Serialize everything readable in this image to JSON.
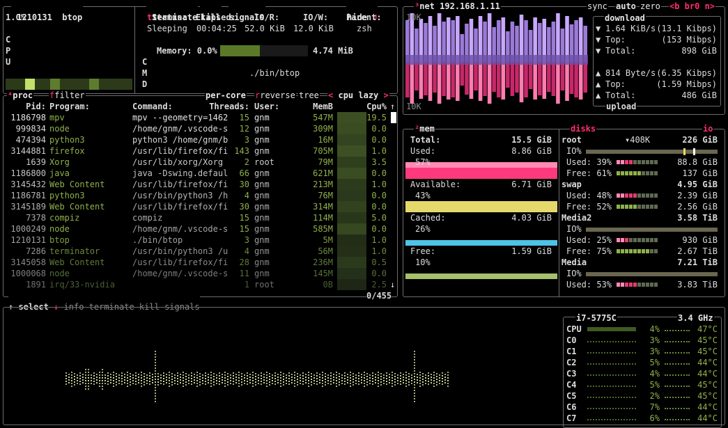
{
  "header": {
    "pid": "1210131",
    "name": "btop",
    "cpu_pct": "1.0%",
    "cpu_letters": [
      "C",
      "P",
      "U"
    ]
  },
  "detail": {
    "buttons": {
      "terminate": "terminate",
      "kill": "kill",
      "signals": "signals",
      "hide": "hide"
    },
    "status_label": "Status:",
    "status": "Sleeping",
    "elapsed_label": "Elapsed:",
    "elapsed": "00:04:25",
    "ior_label": "IO/R:",
    "ior": "52.0 KiB",
    "iow_label": "IO/W:",
    "iow": "12.0 KiB",
    "parent_label": "Parent:",
    "parent": "zsh",
    "memory_label": "Memory: 0.0%",
    "memory_value": "4.74 MiB",
    "cmd_letters": [
      "C",
      "M",
      "D"
    ],
    "command": "./bin/btop",
    "memory_fraction": 0.45
  },
  "proc": {
    "title": "proc",
    "filter": "filter",
    "per_core": "per-core",
    "reverse": "reverse",
    "tree": "tree",
    "sort_label": "cpu lazy",
    "columns": [
      "Pid:",
      "Program:",
      "Command:",
      "Threads:",
      "User:",
      "MemB",
      "Cpu%"
    ],
    "rows": [
      {
        "pid": "1186798",
        "program": "mpv",
        "command": "mpv --geometry=1462",
        "threads": "15",
        "user": "gnm",
        "mem": "547M",
        "cpu": "19.5"
      },
      {
        "pid": "999834",
        "program": "node",
        "command": "/home/gnm/.vscode-s",
        "threads": "12",
        "user": "gnm",
        "mem": "309M",
        "cpu": "0.0"
      },
      {
        "pid": "474394",
        "program": "python3",
        "command": "python3 /home/gnm/b",
        "threads": "3",
        "user": "gnm",
        "mem": "16M",
        "cpu": "0.0"
      },
      {
        "pid": "3144881",
        "program": "firefox",
        "command": "/usr/lib/firefox/fi",
        "threads": "143",
        "user": "gnm",
        "mem": "705M",
        "cpu": "1.0"
      },
      {
        "pid": "1639",
        "program": "Xorg",
        "command": "/usr/lib/xorg/Xorg",
        "threads": "2",
        "user": "root",
        "mem": "79M",
        "cpu": "3.5"
      },
      {
        "pid": "1186800",
        "program": "java",
        "command": "java -Dswing.defaul",
        "threads": "66",
        "user": "gnm",
        "mem": "621M",
        "cpu": "0.0"
      },
      {
        "pid": "3145432",
        "program": "Web Content",
        "command": "/usr/lib/firefox/fi",
        "threads": "30",
        "user": "gnm",
        "mem": "213M",
        "cpu": "1.0"
      },
      {
        "pid": "1186781",
        "program": "python3",
        "command": "/usr/bin/python3 /h",
        "threads": "4",
        "user": "gnm",
        "mem": "76M",
        "cpu": "0.0"
      },
      {
        "pid": "3145189",
        "program": "Web Content",
        "command": "/usr/lib/firefox/fi",
        "threads": "30",
        "user": "gnm",
        "mem": "314M",
        "cpu": "0.0"
      },
      {
        "pid": "7378",
        "program": "compiz",
        "command": "compiz",
        "threads": "15",
        "user": "gnm",
        "mem": "114M",
        "cpu": "5.0"
      },
      {
        "pid": "1000249",
        "program": "node",
        "command": "/home/gnm/.vscode-s",
        "threads": "15",
        "user": "gnm",
        "mem": "585M",
        "cpu": "0.0"
      },
      {
        "pid": "1210131",
        "program": "btop",
        "command": "./bin/btop",
        "threads": "3",
        "user": "gnm",
        "mem": "5M",
        "cpu": "1.0"
      },
      {
        "pid": "7286",
        "program": "terminator",
        "command": "/usr/bin/python3 /u",
        "threads": "4",
        "user": "gnm",
        "mem": "56M",
        "cpu": "1.0"
      },
      {
        "pid": "3145058",
        "program": "Web Content",
        "command": "/usr/lib/firefox/fi",
        "threads": "28",
        "user": "gnm",
        "mem": "236M",
        "cpu": "0.5"
      },
      {
        "pid": "1000068",
        "program": "node",
        "command": "/home/gnm/.vscode-s",
        "threads": "11",
        "user": "gnm",
        "mem": "145M",
        "cpu": "0.0"
      },
      {
        "pid": "1891",
        "program": "irq/33-nvidia",
        "command": "",
        "threads": "1",
        "user": "root",
        "mem": "0B",
        "cpu": "2.5"
      }
    ],
    "footer": {
      "select": "select",
      "info": "info",
      "terminate": "terminate",
      "kill": "kill",
      "signals": "signals",
      "count": "0/455"
    }
  },
  "net": {
    "title": "net",
    "ip": "192.168.1.11",
    "sync": "sync",
    "auto": "auto",
    "zero": "zero",
    "iface": "<b br0 n>",
    "scale_top": "10K",
    "scale_bottom": "10K",
    "download_label": "download",
    "upload_label": "upload",
    "down_rate": "1.64 KiB/s",
    "down_rate_bits": "(13.1 Kibps)",
    "down_top_label": "Top:",
    "down_top": "(153 Mibps)",
    "down_total_label": "Total:",
    "down_total": "898 GiB",
    "up_rate": "814 Byte/s",
    "up_rate_bits": "(6.35 Kibps)",
    "up_top_label": "Top:",
    "up_top": "(1.59 Mibps)",
    "up_total_label": "Total:",
    "up_total": "486 GiB"
  },
  "mem": {
    "title": "mem",
    "total_label": "Total:",
    "total": "15.5 GiB",
    "used_label": "Used:",
    "used": "8.86 GiB",
    "used_pct": "57%",
    "used_frac": 0.57,
    "avail_label": "Available:",
    "avail": "6.71 GiB",
    "avail_pct": "43%",
    "avail_frac": 0.43,
    "cached_label": "Cached:",
    "cached": "4.03 GiB",
    "cached_pct": "26%",
    "cached_frac": 0.26,
    "free_label": "Free:",
    "free": "1.59 GiB",
    "free_pct": "10%",
    "free_frac": 0.1
  },
  "disks": {
    "title": "disks",
    "io_btn": "io",
    "root_name": "root",
    "root_io_rate": "▾408K",
    "root_size": "226 GiB",
    "root_io_label": "IO%",
    "root_used_label": "Used: 39%",
    "root_used": "88.8 GiB",
    "root_free_label": "Free: 61%",
    "root_free": "137 GiB",
    "swap_name": "swap",
    "swap_size": "4.95 GiB",
    "swap_used_label": "Used: 48%",
    "swap_used": "2.39 GiB",
    "swap_free_label": "Free: 52%",
    "swap_free": "2.56 GiB",
    "media2_name": "Media2",
    "media2_size": "3.58 TiB",
    "media2_io_label": "IO%",
    "media2_used_label": "Used: 25%",
    "media2_used": "930 GiB",
    "media2_free_label": "Free: 75%",
    "media2_free": "2.67 TiB",
    "media_name": "Media",
    "media_size": "7.21 TiB",
    "media_io_label": "IO%",
    "media_used_label": "Used: 53%",
    "media_used": "3.83 TiB"
  },
  "cpu": {
    "model": "i7-5775C",
    "freq": "3.4 GHz",
    "cores": [
      {
        "name": "CPU",
        "pct": "4%",
        "temp": "47°C"
      },
      {
        "name": "C0",
        "pct": "3%",
        "temp": "45°C"
      },
      {
        "name": "C1",
        "pct": "3%",
        "temp": "45°C"
      },
      {
        "name": "C2",
        "pct": "5%",
        "temp": "44°C"
      },
      {
        "name": "C3",
        "pct": "4%",
        "temp": "44°C"
      },
      {
        "name": "C4",
        "pct": "5%",
        "temp": "45°C"
      },
      {
        "name": "C5",
        "pct": "2%",
        "temp": "45°C"
      },
      {
        "name": "C6",
        "pct": "7%",
        "temp": "44°C"
      },
      {
        "name": "C7",
        "pct": "6%",
        "temp": "44°C"
      }
    ]
  }
}
